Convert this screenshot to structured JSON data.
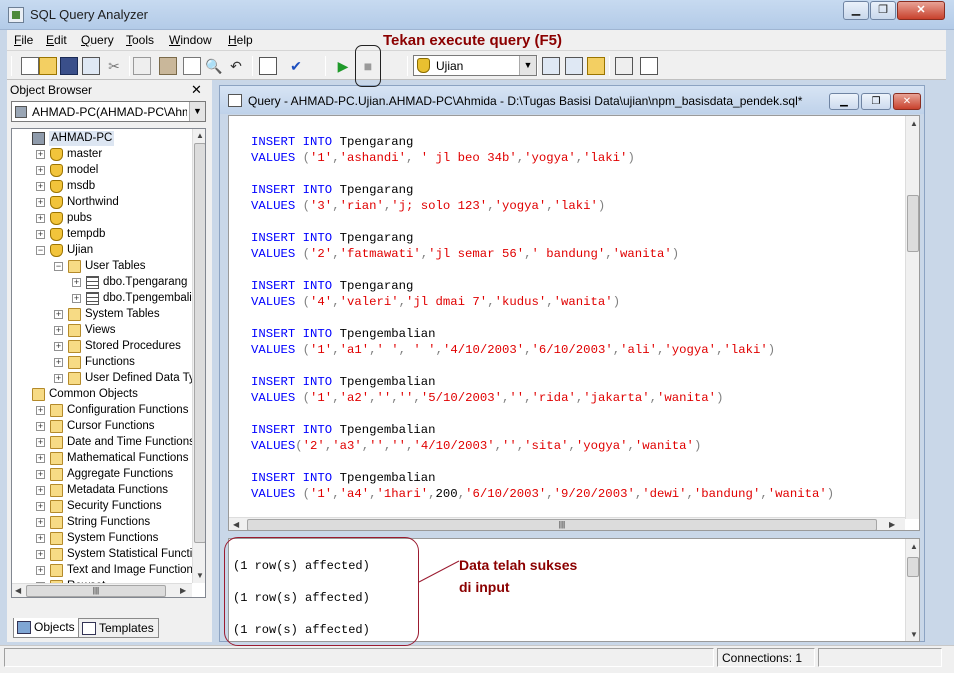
{
  "window": {
    "title": "SQL Query Analyzer",
    "buttons": [
      "minimize",
      "maximize",
      "close"
    ]
  },
  "menu": [
    {
      "label": "File",
      "u": "F",
      "rest": "ile"
    },
    {
      "label": "Edit",
      "u": "E",
      "rest": "dit"
    },
    {
      "label": "Query",
      "u": "Q",
      "rest": "uery"
    },
    {
      "label": "Tools",
      "u": "T",
      "rest": "ools"
    },
    {
      "label": "Window",
      "u": "W",
      "rest": "indow"
    },
    {
      "label": "Help",
      "u": "H",
      "rest": "elp"
    }
  ],
  "toolbar": {
    "database_selected": "Ujian",
    "icons": [
      "new-query-icon",
      "open-icon",
      "save-icon",
      "insert-template-icon",
      "cut-icon",
      "copy-icon",
      "paste-icon",
      "clear-icon",
      "find-icon",
      "undo-icon",
      "results-grid-icon",
      "parse-check-icon",
      "execute-icon",
      "cancel-query-icon",
      "database-icon",
      "display-plan-icon",
      "object-browser-icon",
      "object-search-icon",
      "properties-icon",
      "results-pane-icon"
    ]
  },
  "object_browser": {
    "title": "Object Browser",
    "server_select": "AHMAD-PC(AHMAD-PC\\Ahmida",
    "tree": [
      {
        "label": "AHMAD-PC",
        "icon": "server",
        "level": 0,
        "exp": ""
      },
      {
        "label": "master",
        "icon": "db",
        "level": 1,
        "exp": "+"
      },
      {
        "label": "model",
        "icon": "db",
        "level": 1,
        "exp": "+"
      },
      {
        "label": "msdb",
        "icon": "db",
        "level": 1,
        "exp": "+"
      },
      {
        "label": "Northwind",
        "icon": "db",
        "level": 1,
        "exp": "+"
      },
      {
        "label": "pubs",
        "icon": "db",
        "level": 1,
        "exp": "+"
      },
      {
        "label": "tempdb",
        "icon": "db",
        "level": 1,
        "exp": "+"
      },
      {
        "label": "Ujian",
        "icon": "db",
        "level": 1,
        "exp": "−"
      },
      {
        "label": "User Tables",
        "icon": "folder",
        "level": 2,
        "exp": "−"
      },
      {
        "label": "dbo.Tpengarang",
        "icon": "table",
        "level": 3,
        "exp": "+"
      },
      {
        "label": "dbo.Tpengembalian",
        "icon": "table",
        "level": 3,
        "exp": "+"
      },
      {
        "label": "System Tables",
        "icon": "folder",
        "level": 2,
        "exp": "+"
      },
      {
        "label": "Views",
        "icon": "folder",
        "level": 2,
        "exp": "+"
      },
      {
        "label": "Stored Procedures",
        "icon": "folder",
        "level": 2,
        "exp": "+"
      },
      {
        "label": "Functions",
        "icon": "folder",
        "level": 2,
        "exp": "+"
      },
      {
        "label": "User Defined Data Types",
        "icon": "folder",
        "level": 2,
        "exp": "+"
      },
      {
        "label": "Common Objects",
        "icon": "folder",
        "level": 0,
        "exp": ""
      },
      {
        "label": "Configuration Functions",
        "icon": "folder",
        "level": 1,
        "exp": "+"
      },
      {
        "label": "Cursor Functions",
        "icon": "folder",
        "level": 1,
        "exp": "+"
      },
      {
        "label": "Date and Time Functions",
        "icon": "folder",
        "level": 1,
        "exp": "+"
      },
      {
        "label": "Mathematical Functions",
        "icon": "folder",
        "level": 1,
        "exp": "+"
      },
      {
        "label": "Aggregate Functions",
        "icon": "folder",
        "level": 1,
        "exp": "+"
      },
      {
        "label": "Metadata Functions",
        "icon": "folder",
        "level": 1,
        "exp": "+"
      },
      {
        "label": "Security Functions",
        "icon": "folder",
        "level": 1,
        "exp": "+"
      },
      {
        "label": "String Functions",
        "icon": "folder",
        "level": 1,
        "exp": "+"
      },
      {
        "label": "System Functions",
        "icon": "folder",
        "level": 1,
        "exp": "+"
      },
      {
        "label": "System Statistical Functions",
        "icon": "folder",
        "level": 1,
        "exp": "+"
      },
      {
        "label": "Text and Image Functions",
        "icon": "folder",
        "level": 1,
        "exp": "+"
      },
      {
        "label": "Rowset",
        "icon": "folder",
        "level": 1,
        "exp": "+"
      }
    ],
    "tabs": [
      "Objects",
      "Templates"
    ]
  },
  "query_window": {
    "title": "Query - AHMAD-PC.Ujian.AHMAD-PC\\Ahmida - D:\\Tugas Basisi Data\\ujian\\npm_basisdata_pendek.sql*",
    "code": [
      {
        "kw": "INSERT INTO",
        "table": "Tpengarang",
        "vkw": "VALUES",
        "gap": " ",
        "vals": "('1','ashandi', ' jl beo 34b','yogya','laki')"
      },
      {
        "kw": "INSERT INTO",
        "table": "Tpengarang",
        "vkw": "VALUES",
        "gap": " ",
        "vals": "('3','rian','j; solo 123','yogya','laki')"
      },
      {
        "kw": "INSERT INTO",
        "table": "Tpengarang",
        "vkw": "VALUES",
        "gap": " ",
        "vals": "('2','fatmawati','jl semar 56',' bandung','wanita')"
      },
      {
        "kw": "INSERT INTO",
        "table": "Tpengarang",
        "vkw": "VALUES",
        "gap": " ",
        "vals": "('4','valeri','jl dmai 7','kudus','wanita')"
      },
      {
        "kw": "INSERT INTO",
        "table": "Tpengembalian",
        "vkw": "VALUES",
        "gap": " ",
        "vals": "('1','a1',' ', ' ','4/10/2003','6/10/2003','ali','yogya','laki')"
      },
      {
        "kw": "INSERT INTO",
        "table": "Tpengembalian",
        "vkw": "VALUES",
        "gap": " ",
        "vals": "('1','a2','','','5/10/2003','','rida','jakarta','wanita')"
      },
      {
        "kw": "INSERT INTO",
        "table": "Tpengembalian",
        "vkw": "VALUES",
        "gap": "",
        "vals": "('2','a3','','','4/10/2003','','sita','yogya','wanita')"
      },
      {
        "kw": "INSERT INTO",
        "table": "Tpengembalian",
        "vkw": "VALUES",
        "gap": " ",
        "vals": "('1','a4','1hari',200,'6/10/2003','9/20/2003','dewi','bandung','wanita')"
      }
    ],
    "results": [
      "(1 row(s) affected)",
      "(1 row(s) affected)",
      "(1 row(s) affected)"
    ]
  },
  "status": {
    "connections": "Connections: 1"
  },
  "annotations": {
    "execute_note": "Tekan execute query (F5)",
    "data_note_line1": "Data telah sukses",
    "data_note_line2": "di input"
  },
  "colors": {
    "keyword": "#0000ff",
    "string": "#e00000",
    "annotation": "#8b0000"
  }
}
